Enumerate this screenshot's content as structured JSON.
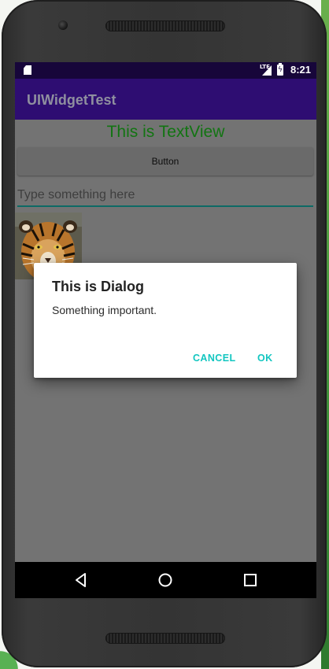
{
  "status_bar": {
    "time": "8:21",
    "network_label": "LTE",
    "icons": [
      "sd-card-icon",
      "signal-icon",
      "battery-charging-icon"
    ]
  },
  "app_bar": {
    "title": "UIWidgetTest",
    "background_color": "#2e0d72"
  },
  "content": {
    "textview": "This is TextView",
    "textview_color": "#127412",
    "button_label": "Button",
    "edit_text_placeholder": "Type something here",
    "edit_text_value": "",
    "image": "tiger-image"
  },
  "dialog": {
    "title": "This is Dialog",
    "message": "Something important.",
    "negative_button": "CANCEL",
    "positive_button": "OK",
    "accent_color": "#12c6c0"
  },
  "nav_bar": {
    "icons": [
      "back-icon",
      "home-icon",
      "recents-icon"
    ]
  }
}
